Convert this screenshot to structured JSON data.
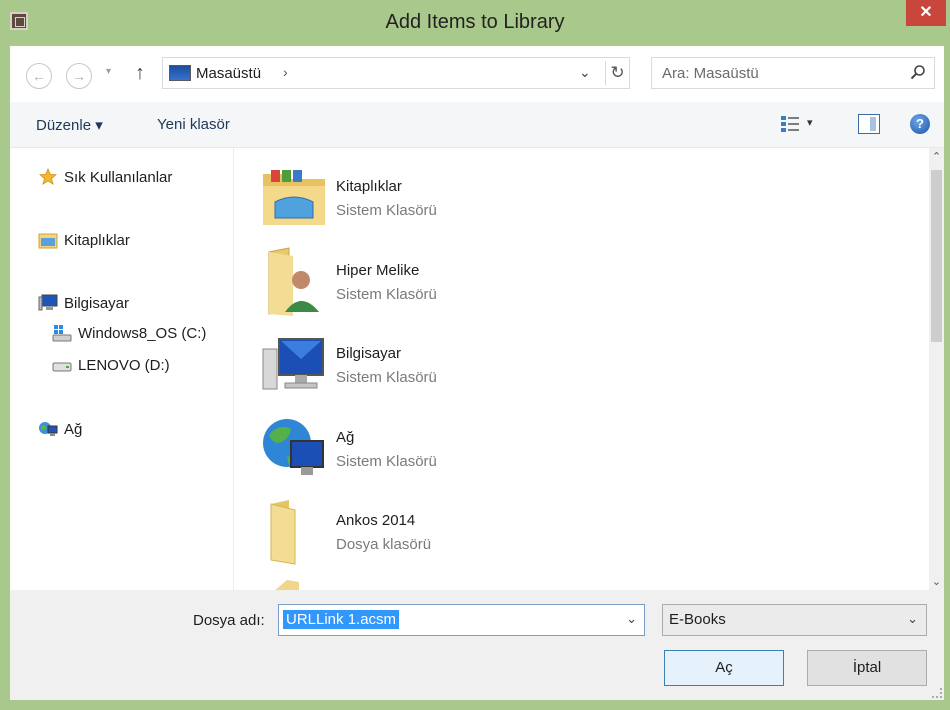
{
  "window": {
    "title": "Add Items to Library",
    "close_label": "✕"
  },
  "address_bar": {
    "back_label": "←",
    "forward_label": "→",
    "recent_label": "▾",
    "up_label": "↑",
    "path": "Masaüstü",
    "path_chevron": "›",
    "dropdown_label": "⌄",
    "refresh_label": "↻",
    "search_placeholder": "Ara: Masaüstü"
  },
  "toolbar": {
    "organize_label": "Düzenle ▾",
    "new_folder_label": "Yeni klasör",
    "view_dropdown": "▾",
    "help_label": "?"
  },
  "sidebar": {
    "items": [
      {
        "label": "Sık Kullanılanlar",
        "icon": "star-icon"
      },
      {
        "label": "Kitaplıklar",
        "icon": "libraries-icon"
      },
      {
        "label": "Bilgisayar",
        "icon": "computer-icon"
      },
      {
        "label": "Windows8_OS (C:)",
        "icon": "windows-drive-icon"
      },
      {
        "label": "LENOVO (D:)",
        "icon": "drive-icon"
      },
      {
        "label": "Ağ",
        "icon": "network-icon"
      }
    ]
  },
  "files": [
    {
      "name": "Kitaplıklar",
      "type": "Sistem Klasörü",
      "icon": "libraries-folder-icon"
    },
    {
      "name": "Hiper Melike",
      "type": "Sistem Klasörü",
      "icon": "user-folder-icon"
    },
    {
      "name": "Bilgisayar",
      "type": "Sistem Klasörü",
      "icon": "computer-icon"
    },
    {
      "name": "Ağ",
      "type": "Sistem Klasörü",
      "icon": "network-globe-icon"
    },
    {
      "name": "Ankos 2014",
      "type": "Dosya klasörü",
      "icon": "folder-icon"
    }
  ],
  "scrollbar": {
    "up_label": "⌃",
    "down_label": "⌄"
  },
  "bottom": {
    "filename_label": "Dosya adı:",
    "filename_value": "URLLink 1.acsm",
    "filename_dropdown": "⌄",
    "filetype_value": "E-Books",
    "filetype_dropdown": "⌄",
    "open_label": "Aç",
    "cancel_label": "İptal"
  },
  "colors": {
    "frame": "#a9c98c",
    "close": "#c9463d",
    "selection": "#3297fd"
  }
}
